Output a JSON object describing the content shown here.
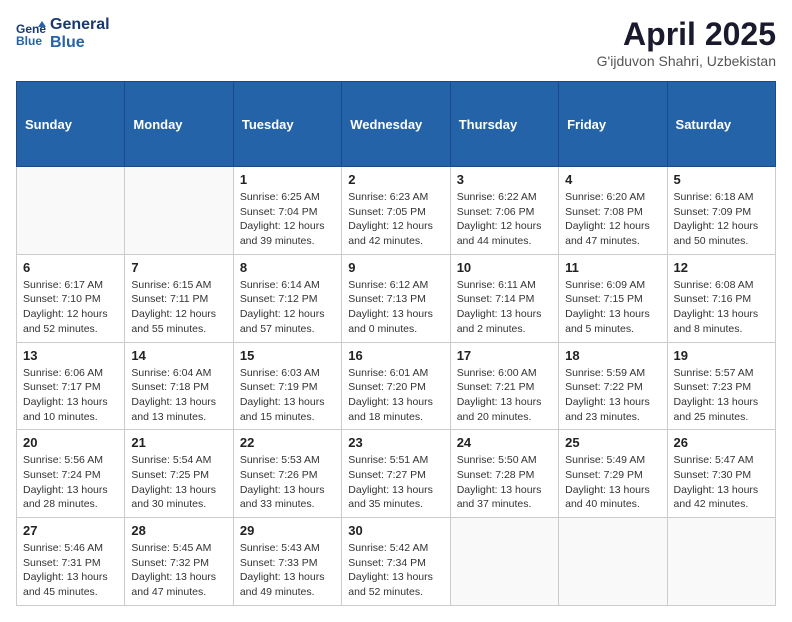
{
  "logo": {
    "line1": "General",
    "line2": "Blue"
  },
  "title": "April 2025",
  "location": "G'ijduvon Shahri, Uzbekistan",
  "weekdays": [
    "Sunday",
    "Monday",
    "Tuesday",
    "Wednesday",
    "Thursday",
    "Friday",
    "Saturday"
  ],
  "weeks": [
    [
      {
        "day": null,
        "info": null
      },
      {
        "day": null,
        "info": null
      },
      {
        "day": "1",
        "sunrise": "6:25 AM",
        "sunset": "7:04 PM",
        "daylight": "12 hours and 39 minutes."
      },
      {
        "day": "2",
        "sunrise": "6:23 AM",
        "sunset": "7:05 PM",
        "daylight": "12 hours and 42 minutes."
      },
      {
        "day": "3",
        "sunrise": "6:22 AM",
        "sunset": "7:06 PM",
        "daylight": "12 hours and 44 minutes."
      },
      {
        "day": "4",
        "sunrise": "6:20 AM",
        "sunset": "7:08 PM",
        "daylight": "12 hours and 47 minutes."
      },
      {
        "day": "5",
        "sunrise": "6:18 AM",
        "sunset": "7:09 PM",
        "daylight": "12 hours and 50 minutes."
      }
    ],
    [
      {
        "day": "6",
        "sunrise": "6:17 AM",
        "sunset": "7:10 PM",
        "daylight": "12 hours and 52 minutes."
      },
      {
        "day": "7",
        "sunrise": "6:15 AM",
        "sunset": "7:11 PM",
        "daylight": "12 hours and 55 minutes."
      },
      {
        "day": "8",
        "sunrise": "6:14 AM",
        "sunset": "7:12 PM",
        "daylight": "12 hours and 57 minutes."
      },
      {
        "day": "9",
        "sunrise": "6:12 AM",
        "sunset": "7:13 PM",
        "daylight": "13 hours and 0 minutes."
      },
      {
        "day": "10",
        "sunrise": "6:11 AM",
        "sunset": "7:14 PM",
        "daylight": "13 hours and 2 minutes."
      },
      {
        "day": "11",
        "sunrise": "6:09 AM",
        "sunset": "7:15 PM",
        "daylight": "13 hours and 5 minutes."
      },
      {
        "day": "12",
        "sunrise": "6:08 AM",
        "sunset": "7:16 PM",
        "daylight": "13 hours and 8 minutes."
      }
    ],
    [
      {
        "day": "13",
        "sunrise": "6:06 AM",
        "sunset": "7:17 PM",
        "daylight": "13 hours and 10 minutes."
      },
      {
        "day": "14",
        "sunrise": "6:04 AM",
        "sunset": "7:18 PM",
        "daylight": "13 hours and 13 minutes."
      },
      {
        "day": "15",
        "sunrise": "6:03 AM",
        "sunset": "7:19 PM",
        "daylight": "13 hours and 15 minutes."
      },
      {
        "day": "16",
        "sunrise": "6:01 AM",
        "sunset": "7:20 PM",
        "daylight": "13 hours and 18 minutes."
      },
      {
        "day": "17",
        "sunrise": "6:00 AM",
        "sunset": "7:21 PM",
        "daylight": "13 hours and 20 minutes."
      },
      {
        "day": "18",
        "sunrise": "5:59 AM",
        "sunset": "7:22 PM",
        "daylight": "13 hours and 23 minutes."
      },
      {
        "day": "19",
        "sunrise": "5:57 AM",
        "sunset": "7:23 PM",
        "daylight": "13 hours and 25 minutes."
      }
    ],
    [
      {
        "day": "20",
        "sunrise": "5:56 AM",
        "sunset": "7:24 PM",
        "daylight": "13 hours and 28 minutes."
      },
      {
        "day": "21",
        "sunrise": "5:54 AM",
        "sunset": "7:25 PM",
        "daylight": "13 hours and 30 minutes."
      },
      {
        "day": "22",
        "sunrise": "5:53 AM",
        "sunset": "7:26 PM",
        "daylight": "13 hours and 33 minutes."
      },
      {
        "day": "23",
        "sunrise": "5:51 AM",
        "sunset": "7:27 PM",
        "daylight": "13 hours and 35 minutes."
      },
      {
        "day": "24",
        "sunrise": "5:50 AM",
        "sunset": "7:28 PM",
        "daylight": "13 hours and 37 minutes."
      },
      {
        "day": "25",
        "sunrise": "5:49 AM",
        "sunset": "7:29 PM",
        "daylight": "13 hours and 40 minutes."
      },
      {
        "day": "26",
        "sunrise": "5:47 AM",
        "sunset": "7:30 PM",
        "daylight": "13 hours and 42 minutes."
      }
    ],
    [
      {
        "day": "27",
        "sunrise": "5:46 AM",
        "sunset": "7:31 PM",
        "daylight": "13 hours and 45 minutes."
      },
      {
        "day": "28",
        "sunrise": "5:45 AM",
        "sunset": "7:32 PM",
        "daylight": "13 hours and 47 minutes."
      },
      {
        "day": "29",
        "sunrise": "5:43 AM",
        "sunset": "7:33 PM",
        "daylight": "13 hours and 49 minutes."
      },
      {
        "day": "30",
        "sunrise": "5:42 AM",
        "sunset": "7:34 PM",
        "daylight": "13 hours and 52 minutes."
      },
      {
        "day": null,
        "info": null
      },
      {
        "day": null,
        "info": null
      },
      {
        "day": null,
        "info": null
      }
    ]
  ]
}
